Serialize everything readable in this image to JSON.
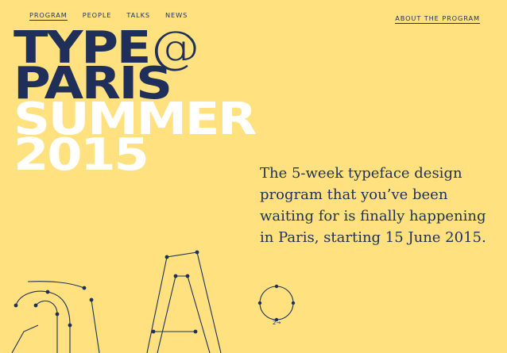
{
  "nav": {
    "left": [
      {
        "label": "PROGRAM"
      },
      {
        "label": "PEOPLE"
      },
      {
        "label": "TALKS"
      },
      {
        "label": "NEWS"
      }
    ],
    "right": {
      "label": "ABOUT THE PROGRAM"
    }
  },
  "hero": {
    "line1": "TYPE",
    "at": "@",
    "line2": "PARIS",
    "line3": "SUMMER",
    "line4": "2015"
  },
  "intro": {
    "text": "The 5-week typeface design program that you’ve been waiting for is finally happening in Paris, starting 15 June 2015."
  },
  "diagram": {
    "label": "2→"
  },
  "colors": {
    "background": "#ffe27f",
    "navy": "#1f2f5a",
    "white": "#ffffff"
  }
}
